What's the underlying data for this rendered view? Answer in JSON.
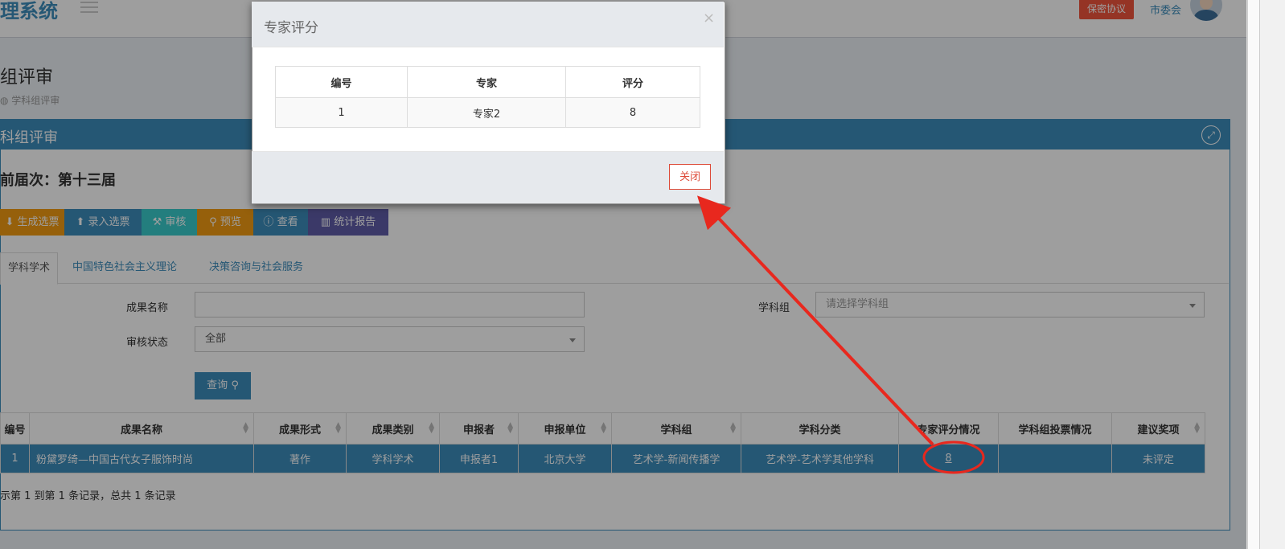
{
  "header": {
    "logo": "理系统",
    "secret_button": "保密协议",
    "user_name": "市委会"
  },
  "page": {
    "title": "组评审",
    "breadcrumb": "学科组评审"
  },
  "box": {
    "title": "科组评审",
    "session": "前届次：第十三届"
  },
  "toolbar": {
    "generate": "生成选票",
    "enter": "录入选票",
    "review": "审核",
    "preview": "预览",
    "view": "查看",
    "report": "统计报告"
  },
  "tabs": [
    {
      "label": "学科学术"
    },
    {
      "label": "中国特色社会主义理论"
    },
    {
      "label": "决策咨询与社会服务"
    }
  ],
  "form": {
    "name_label": "成果名称",
    "name_value": "",
    "group_label": "学科组",
    "group_placeholder": "请选择学科组",
    "status_label": "审核状态",
    "status_value": "全部",
    "query_button": "查询"
  },
  "table": {
    "headers": [
      "编号",
      "成果名称",
      "成果形式",
      "成果类别",
      "申报者",
      "申报单位",
      "学科组",
      "学科分类",
      "专家评分情况",
      "学科组投票情况",
      "建议奖项"
    ],
    "rows": [
      [
        "1",
        "粉黛罗绮—中国古代女子服饰时尚",
        "著作",
        "学科学术",
        "申报者1",
        "北京大学",
        "艺术学-新闻传播学",
        "艺术学-艺术学其他学科",
        "8",
        "",
        "未评定"
      ]
    ]
  },
  "pager": {
    "info": "示第 1 到第 1 条记录，总共 1 条记录"
  },
  "modal": {
    "title": "专家评分",
    "headers": [
      "编号",
      "专家",
      "评分"
    ],
    "rows": [
      [
        "1",
        "专家2",
        "8"
      ]
    ],
    "close_button": "关闭"
  },
  "colors": {
    "primary": "#3c8dbc",
    "annotation": "#e8281e",
    "secret": "#f0543c"
  }
}
